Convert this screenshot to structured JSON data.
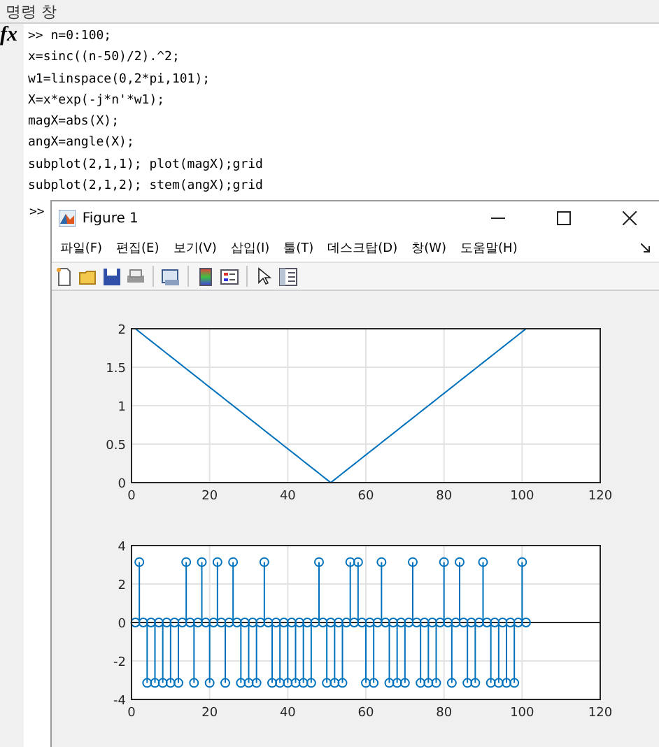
{
  "command_window": {
    "title": "명령 창",
    "lines": [
      ">> n=0:100;",
      "x=sinc((n-50)/2).^2;",
      "w1=linspace(0,2*pi,101);",
      "X=x*exp(-j*n'*w1);",
      "magX=abs(X);",
      "angX=angle(X);",
      "subplot(2,1,1); plot(magX);grid",
      "subplot(2,1,2); stem(angX);grid"
    ],
    "fx": "fx",
    "prompt": ">>"
  },
  "figure": {
    "title": "Figure 1",
    "menu": [
      "파일(F)",
      "편집(E)",
      "보기(V)",
      "삽입(I)",
      "툴(T)",
      "데스크탑(D)",
      "창(W)",
      "도움말(H)"
    ],
    "axes": [
      {
        "chart_data": {
          "type": "line",
          "x": [
            1,
            2,
            3,
            4,
            5,
            6,
            7,
            8,
            9,
            10,
            11,
            12,
            13,
            14,
            15,
            16,
            17,
            18,
            19,
            20,
            21,
            22,
            23,
            24,
            25,
            26,
            27,
            28,
            29,
            30,
            31,
            32,
            33,
            34,
            35,
            36,
            37,
            38,
            39,
            40,
            41,
            42,
            43,
            44,
            45,
            46,
            47,
            48,
            49,
            50,
            51,
            52,
            53,
            54,
            55,
            56,
            57,
            58,
            59,
            60,
            61,
            62,
            63,
            64,
            65,
            66,
            67,
            68,
            69,
            70,
            71,
            72,
            73,
            74,
            75,
            76,
            77,
            78,
            79,
            80,
            81,
            82,
            83,
            84,
            85,
            86,
            87,
            88,
            89,
            90,
            91,
            92,
            93,
            94,
            95,
            96,
            97,
            98,
            99,
            100,
            101
          ],
          "grid": true,
          "series": [
            {
              "color": "#0072bd",
              "values": [
                2,
                1.96,
                1.92,
                1.88,
                1.84,
                1.8,
                1.76,
                1.72,
                1.68,
                1.64,
                1.6,
                1.56,
                1.52,
                1.48,
                1.44,
                1.4,
                1.36,
                1.32,
                1.28,
                1.24,
                1.2,
                1.16,
                1.12,
                1.08,
                1.04,
                1,
                0.96,
                0.92,
                0.88,
                0.84,
                0.8,
                0.76,
                0.72,
                0.68,
                0.64,
                0.6,
                0.56,
                0.52,
                0.48,
                0.44,
                0.4,
                0.36,
                0.32,
                0.28,
                0.24,
                0.2,
                0.16,
                0.12,
                0.08,
                0.04,
                0,
                0.04,
                0.08,
                0.12,
                0.16,
                0.2,
                0.24,
                0.28,
                0.32,
                0.36,
                0.4,
                0.44,
                0.48,
                0.52,
                0.56,
                0.6,
                0.64,
                0.68,
                0.72,
                0.76,
                0.8,
                0.84,
                0.88,
                0.92,
                0.96,
                1,
                1.04,
                1.08,
                1.12,
                1.16,
                1.2,
                1.24,
                1.28,
                1.32,
                1.36,
                1.4,
                1.44,
                1.48,
                1.52,
                1.56,
                1.6,
                1.64,
                1.68,
                1.72,
                1.76,
                1.8,
                1.84,
                1.88,
                1.92,
                1.96,
                2
              ]
            }
          ],
          "xlim": [
            0,
            120
          ],
          "ylim": [
            0,
            2
          ],
          "xticks": [
            0,
            20,
            40,
            60,
            80,
            100,
            120
          ],
          "yticks": [
            0,
            {
              "value": 0.5,
              "label": "0.5"
            },
            1,
            {
              "value": 1.5,
              "label": "1.5"
            },
            2
          ]
        }
      },
      {
        "chart_data": {
          "type": "scatter",
          "x": [
            1,
            2,
            3,
            4,
            5,
            6,
            7,
            8,
            9,
            10,
            11,
            12,
            13,
            14,
            15,
            16,
            17,
            18,
            19,
            20,
            21,
            22,
            23,
            24,
            25,
            26,
            27,
            28,
            29,
            30,
            31,
            32,
            33,
            34,
            35,
            36,
            37,
            38,
            39,
            40,
            41,
            42,
            43,
            44,
            45,
            46,
            47,
            48,
            49,
            50,
            51,
            52,
            53,
            54,
            55,
            56,
            57,
            58,
            59,
            60,
            61,
            62,
            63,
            64,
            65,
            66,
            67,
            68,
            69,
            70,
            71,
            72,
            73,
            74,
            75,
            76,
            77,
            78,
            79,
            80,
            81,
            82,
            83,
            84,
            85,
            86,
            87,
            88,
            89,
            90,
            91,
            92,
            93,
            94,
            95,
            96,
            97,
            98,
            99,
            100,
            101
          ],
          "grid": true,
          "series": [
            {
              "color": "#0072bd",
              "values": [
                0,
                3.14,
                0,
                -3.14,
                0,
                -3.14,
                0,
                -3.14,
                0,
                -3.14,
                0,
                -3.14,
                0,
                3.14,
                0,
                -3.14,
                0,
                3.14,
                0,
                -3.14,
                0,
                3.14,
                0,
                -3.14,
                0,
                3.14,
                0,
                -3.14,
                0,
                -3.14,
                0,
                -3.14,
                0,
                3.14,
                0,
                -3.14,
                0,
                -3.14,
                0,
                -3.14,
                0,
                -3.14,
                0,
                -3.14,
                0,
                -3.14,
                0,
                3.14,
                0,
                -3.14,
                0,
                -3.14,
                0,
                -3.14,
                0,
                3.14,
                0,
                3.14,
                0,
                -3.14,
                0,
                -3.14,
                0,
                3.14,
                0,
                -3.14,
                0,
                -3.14,
                0,
                -3.14,
                0,
                3.14,
                0,
                -3.14,
                0,
                -3.14,
                0,
                -3.14,
                0,
                3.14,
                0,
                -3.14,
                0,
                3.14,
                0,
                -3.14,
                0,
                -3.14,
                0,
                3.14,
                0,
                -3.14,
                0,
                -3.14,
                0,
                -3.14,
                0,
                -3.14,
                0,
                3.14,
                0
              ]
            }
          ],
          "xlim": [
            0,
            120
          ],
          "ylim": [
            -4,
            4
          ],
          "xticks": [
            0,
            20,
            40,
            60,
            80,
            100,
            120
          ],
          "yticks": [
            -4,
            -2,
            0,
            2,
            4
          ]
        }
      }
    ]
  }
}
